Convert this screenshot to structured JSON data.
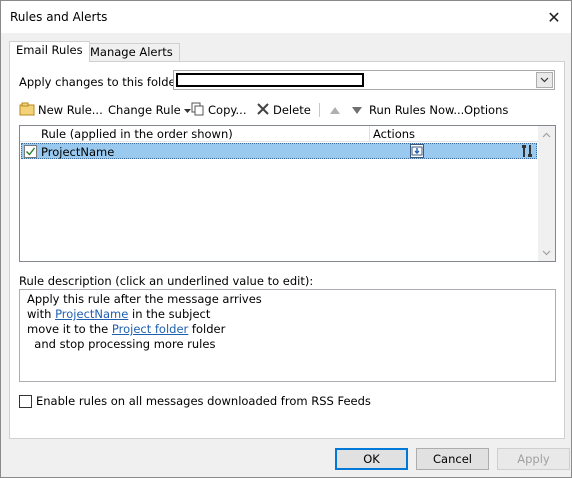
{
  "window": {
    "title": "Rules and Alerts",
    "close_glyph": "✕"
  },
  "tabs": [
    {
      "label": "Email Rules",
      "active": true
    },
    {
      "label": "Manage Alerts",
      "active": false
    }
  ],
  "folder": {
    "label": "Apply changes to this folder:"
  },
  "toolbar": {
    "new_rule": "New Rule...",
    "change_rule": "Change Rule",
    "copy": "Copy...",
    "delete": "Delete",
    "run_rules_now": "Run Rules Now...",
    "options": "Options"
  },
  "rules_list": {
    "columns": [
      "Rule (applied in the order shown)",
      "Actions"
    ],
    "rows": [
      {
        "name": "ProjectName",
        "checked": true,
        "selected": true
      }
    ]
  },
  "description": {
    "label": "Rule description (click an underlined value to edit):",
    "line1": "Apply this rule after the message arrives",
    "line2_prefix": "with ",
    "line2_link": "ProjectName",
    "line2_suffix": " in the subject",
    "line3_prefix": "move it to the ",
    "line3_link": "Project folder",
    "line3_suffix": " folder",
    "line4": "  and stop processing more rules"
  },
  "rss": {
    "label": "Enable rules on all messages downloaded from RSS Feeds",
    "checked": false
  },
  "buttons": {
    "ok": "OK",
    "cancel": "Cancel",
    "apply": "Apply"
  },
  "colors": {
    "selection": "#99c9ef",
    "link": "#1f5fb0",
    "default_border": "#0078d7"
  }
}
